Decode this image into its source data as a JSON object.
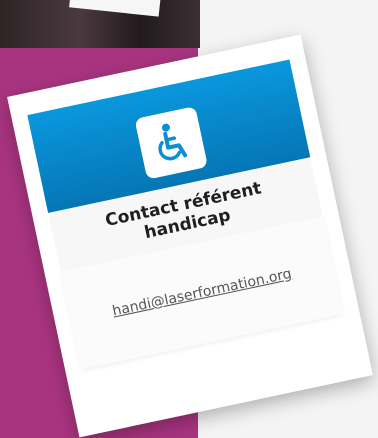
{
  "card": {
    "title": "Contact référent handicap",
    "email": "handi@laserformation.org",
    "icon": "wheelchair-icon"
  },
  "colors": {
    "header_top": "#0a97dd",
    "header_bottom": "#0576b5",
    "magenta_panel": "#a8347f"
  }
}
